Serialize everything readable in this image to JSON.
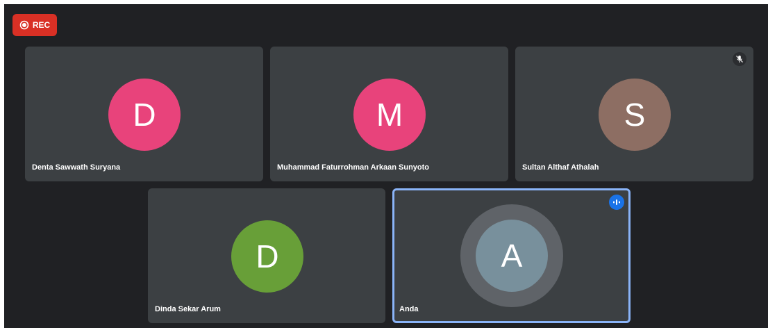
{
  "recording": {
    "label": "REC",
    "color": "#d93025"
  },
  "participants": [
    {
      "initial": "D",
      "name": "Denta Sawwath Suryana",
      "avatar_color": "#e8437b",
      "muted": false,
      "speaking": false
    },
    {
      "initial": "M",
      "name": "Muhammad Faturrohman Arkaan Sunyoto",
      "avatar_color": "#e8437b",
      "muted": false,
      "speaking": false
    },
    {
      "initial": "S",
      "name": "Sultan Althaf Athalah",
      "avatar_color": "#8d6e63",
      "muted": true,
      "speaking": false,
      "status_icon": "mic-off-icon"
    },
    {
      "initial": "D",
      "name": "Dinda Sekar Arum",
      "avatar_color": "#689f38",
      "muted": false,
      "speaking": false
    },
    {
      "initial": "A",
      "name": "Anda",
      "avatar_color": "#78909c",
      "muted": false,
      "speaking": true,
      "status_icon": "audio-level-icon"
    }
  ],
  "colors": {
    "background": "#202124",
    "tile": "#3c4043",
    "active_border": "#8ab4f8"
  }
}
